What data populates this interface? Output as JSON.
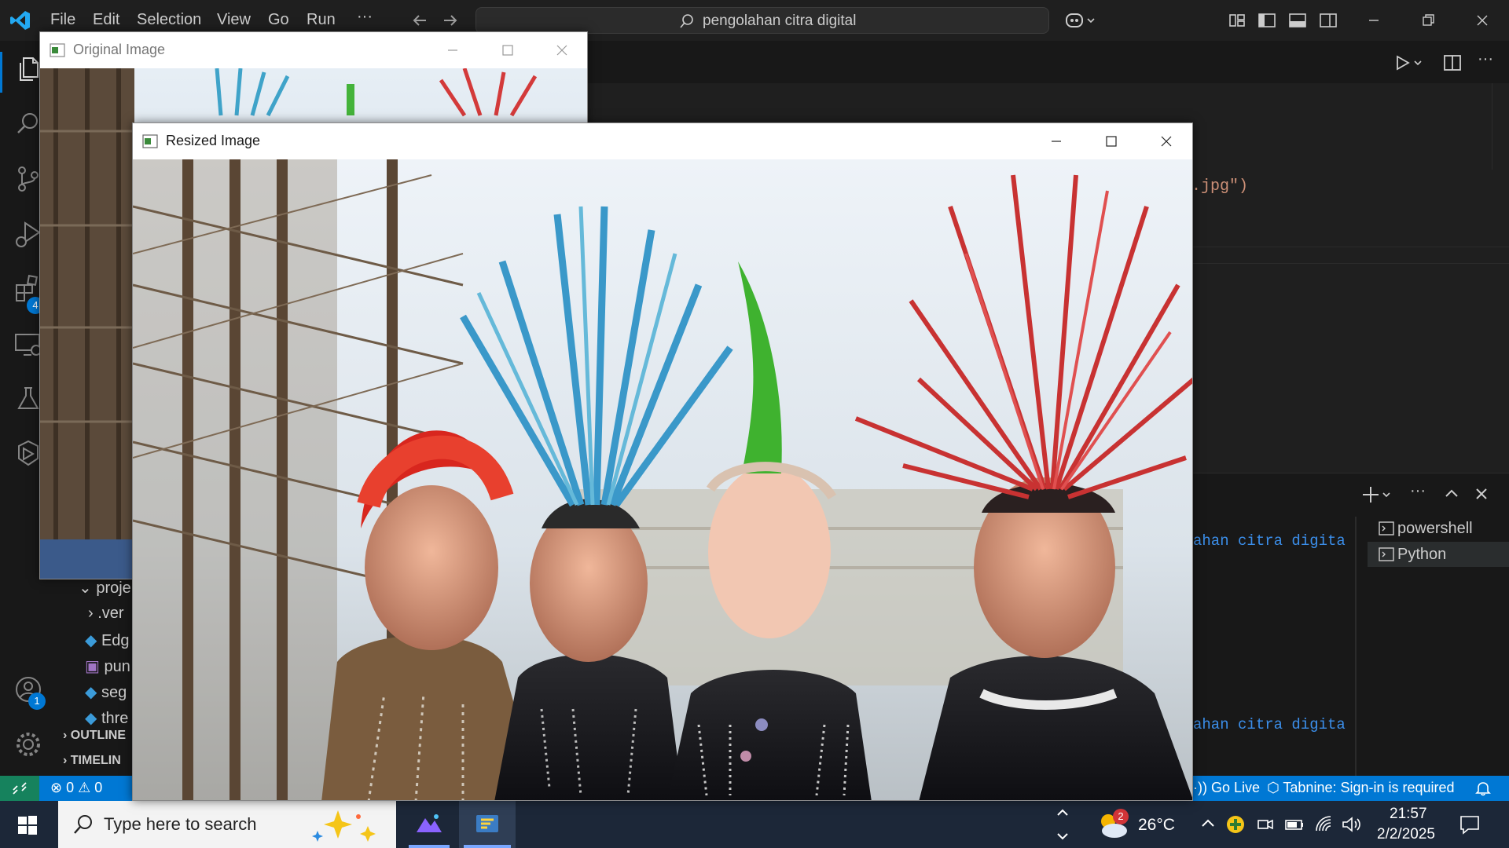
{
  "titlebar": {
    "menu": [
      "File",
      "Edit",
      "Selection",
      "View",
      "Go",
      "Run",
      "···"
    ],
    "search_text": "pengolahan citra digital"
  },
  "activitybar": {
    "extensions_badge": "4",
    "accounts_badge": "1"
  },
  "sidebar": {
    "items": [
      "proje",
      ".ver",
      "Edg",
      "pun",
      "seg",
      "thre"
    ],
    "outline_label": "OUTLINE",
    "timeline_label": "TIMELIN"
  },
  "editor": {
    "code_fragment": ".jpg\")"
  },
  "panel": {
    "terminal_lines": [
      "ahan citra digita",
      "ahan citra digita"
    ],
    "terminal_tabs": [
      "powershell",
      "Python"
    ]
  },
  "statusbar": {
    "errors": "0",
    "warnings": "0",
    "go_live": "Go Live",
    "tabnine": "Tabnine: Sign-in is required"
  },
  "taskbar": {
    "search_placeholder": "Type here to search",
    "weather_badge": "2",
    "temperature": "26°C",
    "time": "21:57",
    "date": "2/2/2025"
  },
  "windows": {
    "original_title": "Original Image",
    "resized_title": "Resized Image"
  },
  "colors": {
    "statusbar": "#0078d4",
    "taskbar": "#1c2738",
    "editor_bg": "#1f1f1f"
  }
}
